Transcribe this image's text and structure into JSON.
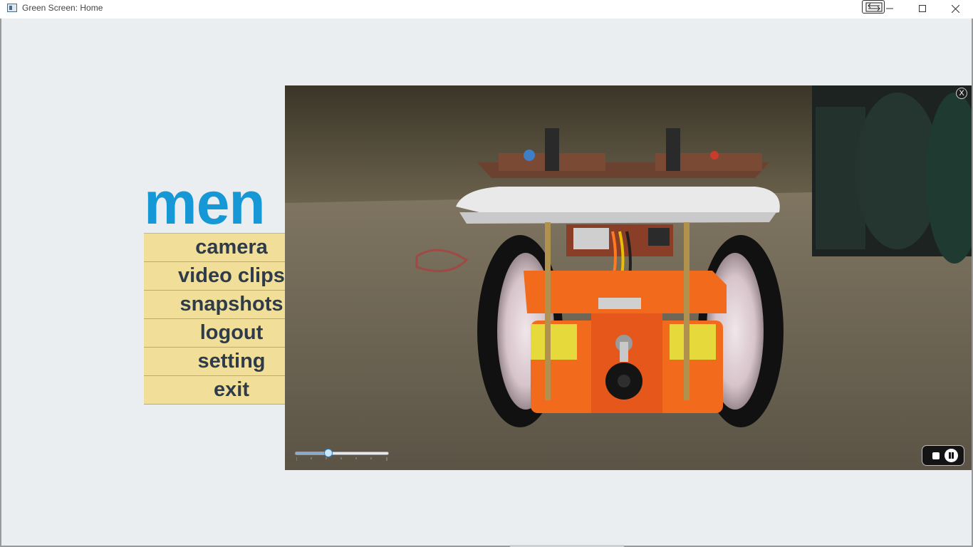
{
  "window": {
    "title": "Green Screen: Home"
  },
  "menu": {
    "title": "men",
    "items": [
      {
        "label": "camera"
      },
      {
        "label": "video clips"
      },
      {
        "label": "snapshots"
      },
      {
        "label": "logout"
      },
      {
        "label": "setting"
      },
      {
        "label": "exit"
      }
    ]
  },
  "video": {
    "close_label": "X",
    "seek_position": 0.34,
    "state": "playing"
  },
  "colors": {
    "menu_title": "#1798d6",
    "menu_item_bg": "#f1df99",
    "menu_item_text": "#2e3b4a",
    "window_bg": "#ebeef0"
  },
  "icons": {
    "app": "app-icon",
    "snap": "snap-layout-icon",
    "minimize": "minimize-icon",
    "maximize": "maximize-icon",
    "close": "close-icon",
    "stop": "stop-icon",
    "pause": "pause-icon"
  }
}
